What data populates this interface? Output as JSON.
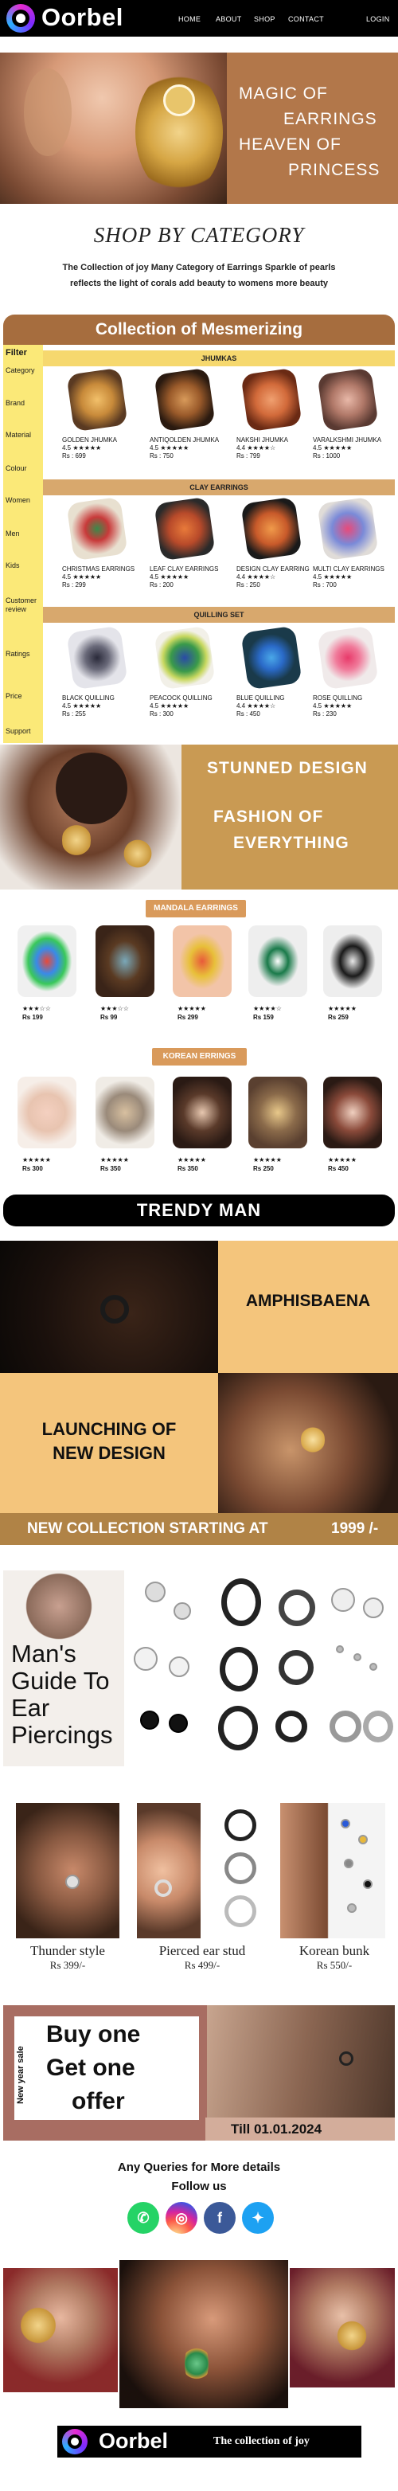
{
  "header": {
    "brand": "Oorbel",
    "nav": [
      "HOME",
      "ABOUT",
      "SHOP",
      "CONTACT"
    ],
    "login": "LOGIN"
  },
  "hero": {
    "lines": [
      "MAGIC OF",
      "EARRINGS",
      "HEAVEN OF",
      "PRINCESS"
    ]
  },
  "category": {
    "title": "SHOP BY CATEGORY",
    "desc1": "The Collection of joy Many Category of  Earrings Sparkle of pearls",
    "desc2": "reflects the light of corals add beauty to womens more beauty"
  },
  "collection": {
    "title": "Collection of Mesmerizing",
    "filters": [
      "Filter",
      "Category",
      "Brand",
      "Material",
      "Colour",
      "Women",
      "Men",
      "Kids",
      "Customer review",
      "Ratings",
      "Price",
      "Support"
    ],
    "groups": [
      {
        "name": "JHUMKAS",
        "items": [
          {
            "name": "GOLDEN JHUMKA",
            "rating": "4.5 ★★★★★",
            "price": "Rs : 699"
          },
          {
            "name": "ANTIQOLDEN JHUMKA",
            "rating": "4.5 ★★★★★",
            "price": "Rs : 750"
          },
          {
            "name": "NAKSHI JHUMKA",
            "rating": "4.4 ★★★★☆",
            "price": "Rs : 799"
          },
          {
            "name": "VARALKSHMI JHUMKA",
            "rating": "4.5 ★★★★★",
            "price": "Rs : 1000"
          }
        ]
      },
      {
        "name": "CLAY EARRINGS",
        "items": [
          {
            "name": "CHRISTMAS  EARRINGS",
            "rating": "4.5 ★★★★★",
            "price": "Rs : 299"
          },
          {
            "name": "LEAF CLAY EARRINGS",
            "rating": "4.5 ★★★★★",
            "price": "Rs : 200"
          },
          {
            "name": "DESIGN CLAY EARRING",
            "rating": "4.4 ★★★★☆",
            "price": "Rs : 250"
          },
          {
            "name": "MULTI CLAY EARRINGS",
            "rating": "4.5 ★★★★★",
            "price": "Rs : 700"
          }
        ]
      },
      {
        "name": "QUILLING SET",
        "items": [
          {
            "name": "BLACK QUILLING",
            "rating": "4.5 ★★★★★",
            "price": "Rs : 255"
          },
          {
            "name": "PEACOCK QUILLING",
            "rating": "4.5 ★★★★★",
            "price": "Rs : 300"
          },
          {
            "name": "BLUE  QUILLING",
            "rating": "4.4 ★★★★☆",
            "price": "Rs : 450"
          },
          {
            "name": "ROSE QUILLING",
            "rating": "4.5 ★★★★★",
            "price": "Rs : 230"
          }
        ]
      }
    ]
  },
  "stunned": {
    "line1": "STUNNED DESIGN",
    "line2": "FASHION OF",
    "line3": "EVERYTHING"
  },
  "mandala": {
    "label": "MANDALA EARRINGS",
    "items": [
      {
        "rating": "★★★☆☆",
        "price": "Rs 199"
      },
      {
        "rating": "★★★☆☆",
        "price": "Rs 99"
      },
      {
        "rating": "★★★★★",
        "price": "Rs 299"
      },
      {
        "rating": "★★★★☆",
        "price": "Rs 159"
      },
      {
        "rating": "★★★★★",
        "price": "Rs 259"
      }
    ]
  },
  "korean": {
    "label": "KOREAN ERRINGS",
    "items": [
      {
        "rating": "★★★★★",
        "price": "Rs 300"
      },
      {
        "rating": "★★★★★",
        "price": "Rs 350"
      },
      {
        "rating": "★★★★★",
        "price": "Rs 350"
      },
      {
        "rating": "★★★★★",
        "price": "Rs 250"
      },
      {
        "rating": "★★★★★",
        "price": "Rs 450"
      }
    ]
  },
  "trendy": {
    "title": "TRENDY  MAN"
  },
  "amphis": {
    "title": "AMPHISBAENA"
  },
  "launch": {
    "line1": "LAUNCHING OF",
    "line2": "NEW DESIGN"
  },
  "newcol": {
    "text": "NEW COLLECTION STARTING AT",
    "price": "1999 /-"
  },
  "guide": {
    "lines": [
      "Man's",
      "Guide To",
      "Ear",
      "Piercings"
    ]
  },
  "styles": [
    {
      "caption": "Thunder style",
      "price": "Rs 399/-"
    },
    {
      "caption": "Pierced ear stud",
      "price": "Rs 499/-"
    },
    {
      "caption": "Korean bunk",
      "price": "Rs 550/-"
    }
  ],
  "offer": {
    "vertical": "New year sale",
    "lines": [
      "Buy one",
      "Get one",
      "offer"
    ],
    "till": "Till   01.01.2024"
  },
  "footer": {
    "queries": "Any Queries for More details",
    "follow": "Follow  us",
    "social": [
      "whatsapp-icon",
      "instagram-icon",
      "facebook-icon",
      "twitter-icon"
    ],
    "brand": "Oorbel",
    "tagline": "The collection of joy"
  },
  "colors": {
    "brown": "#a66d3e",
    "yellow": "#fbe978",
    "orange": "#f4c57c",
    "gold": "#b08346"
  }
}
